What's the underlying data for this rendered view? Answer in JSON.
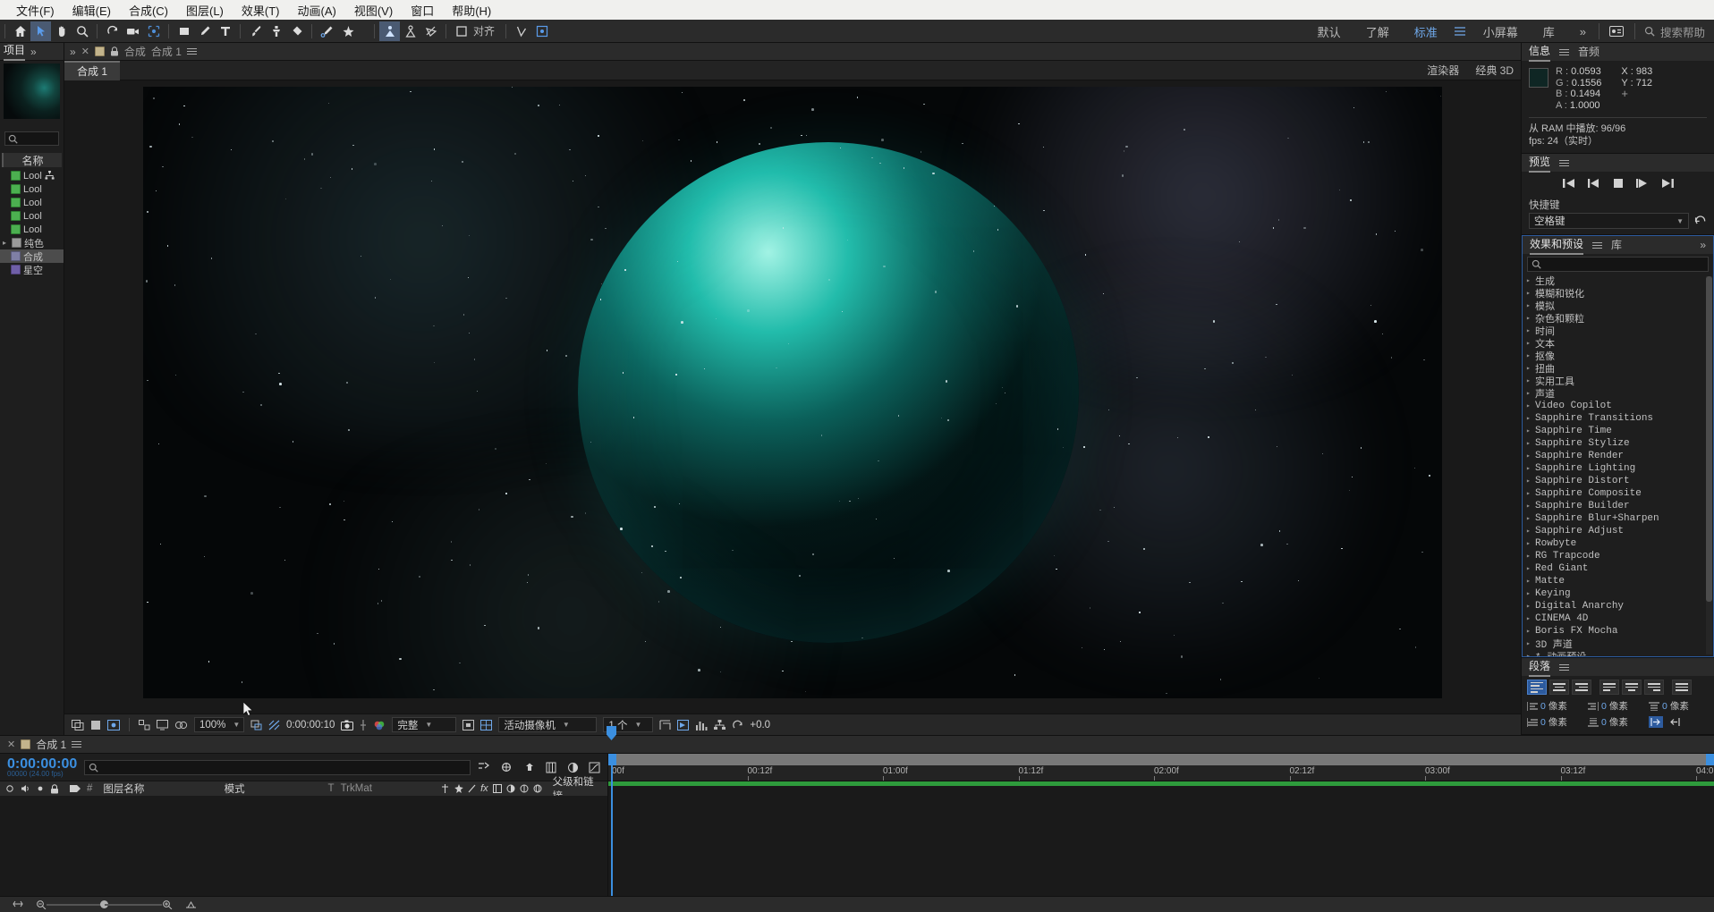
{
  "menu": {
    "items": [
      "文件(F)",
      "编辑(E)",
      "合成(C)",
      "图层(L)",
      "效果(T)",
      "动画(A)",
      "视图(V)",
      "窗口",
      "帮助(H)"
    ]
  },
  "toolbar": {
    "align_label": "对齐",
    "workspaces": [
      "默认",
      "了解",
      "标准",
      "小屏幕"
    ],
    "active_workspace": "标准",
    "library_label": "库",
    "overflow": "»",
    "search_placeholder": "搜索帮助"
  },
  "project": {
    "tab": "项目",
    "overflow": "»",
    "column_name": "名称",
    "items": [
      {
        "label": "Lool",
        "type": "green"
      },
      {
        "label": "Lool",
        "type": "green"
      },
      {
        "label": "Lool",
        "type": "green"
      },
      {
        "label": "Lool",
        "type": "green"
      },
      {
        "label": "Lool",
        "type": "green"
      },
      {
        "label": "纯色",
        "type": "grey"
      },
      {
        "label": "合成",
        "type": "comp"
      },
      {
        "label": "星空",
        "type": "vio"
      }
    ]
  },
  "composition": {
    "breadcrumb_root": "合成",
    "breadcrumb_current": "合成 1",
    "tab_label": "合成 1",
    "renderer_label": "渲染器",
    "renderer_value": "经典 3D",
    "footer": {
      "zoom": "100%",
      "time": "0:00:00:10",
      "quality": "完整",
      "camera": "活动摄像机",
      "views": "1 个",
      "exposure": "+0.0"
    }
  },
  "info_panel": {
    "tab": "信息",
    "tab2": "音频",
    "channels": [
      {
        "key": "R :",
        "value": "0.0593"
      },
      {
        "key": "G :",
        "value": "0.1556"
      },
      {
        "key": "B :",
        "value": "0.1494"
      },
      {
        "key": "A :",
        "value": "1.0000"
      }
    ],
    "x": "X : 983",
    "y": "Y : 712",
    "ram_line": "从 RAM 中播放: 96/96",
    "fps_line": "fps: 24（实时）"
  },
  "preview_panel": {
    "tab": "预览",
    "shortcut_label": "快捷键",
    "shortcut_value": "空格键"
  },
  "effects_panel": {
    "tab": "效果和预设",
    "tab2": "库",
    "overflow": "»",
    "items": [
      "* 动画预设",
      "3D 声道",
      "Boris FX Mocha",
      "CINEMA 4D",
      "Digital Anarchy",
      "Keying",
      "Matte",
      "Red Giant",
      "RG Trapcode",
      "Rowbyte",
      "Sapphire Adjust",
      "Sapphire Blur+Sharpen",
      "Sapphire Builder",
      "Sapphire Composite",
      "Sapphire Distort",
      "Sapphire Lighting",
      "Sapphire Render",
      "Sapphire Stylize",
      "Sapphire Time",
      "Sapphire Transitions",
      "Video Copilot",
      "声道",
      "实用工具",
      "扭曲",
      "抠像",
      "文本",
      "时间",
      "杂色和颗粒",
      "模拟",
      "模糊和锐化",
      "生成"
    ]
  },
  "paragraph_panel": {
    "tab": "段落",
    "fields": [
      {
        "value": "0",
        "unit": "像素"
      },
      {
        "value": "0",
        "unit": "像素"
      },
      {
        "value": "0",
        "unit": "像素"
      },
      {
        "value": "0",
        "unit": "像素"
      },
      {
        "value": "0",
        "unit": "像素"
      }
    ]
  },
  "timeline": {
    "tab_label": "合成 1",
    "current_time": "0:00:00:00",
    "current_time_sub": "00000 (24.00 fps)",
    "columns": {
      "layer_name": "图层名称",
      "mode": "模式",
      "trkmat": "TrkMat",
      "parent": "父级和链接",
      "t": "T"
    },
    "ruler_ticks": [
      "00f",
      "00:12f",
      "01:00f",
      "01:12f",
      "02:00f",
      "02:12f",
      "03:00f",
      "03:12f",
      "04:0"
    ]
  }
}
